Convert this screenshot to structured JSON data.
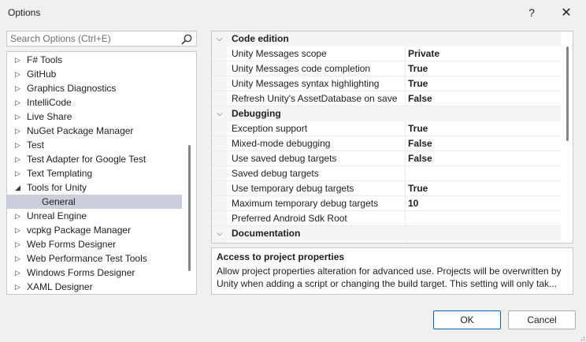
{
  "window": {
    "title": "Options",
    "help_glyph": "?",
    "close_glyph": "✕"
  },
  "search": {
    "placeholder": "Search Options (Ctrl+E)"
  },
  "tree": [
    {
      "label": "F# Tools",
      "arrow": "▷"
    },
    {
      "label": "GitHub",
      "arrow": "▷"
    },
    {
      "label": "Graphics Diagnostics",
      "arrow": "▷"
    },
    {
      "label": "IntelliCode",
      "arrow": "▷"
    },
    {
      "label": "Live Share",
      "arrow": "▷"
    },
    {
      "label": "NuGet Package Manager",
      "arrow": "▷"
    },
    {
      "label": "Test",
      "arrow": "▷"
    },
    {
      "label": "Test Adapter for Google Test",
      "arrow": "▷"
    },
    {
      "label": "Text Templating",
      "arrow": "▷"
    },
    {
      "label": "Tools for Unity",
      "arrow": "◢"
    },
    {
      "label": "General",
      "arrow": ""
    },
    {
      "label": "Unreal Engine",
      "arrow": "▷"
    },
    {
      "label": "vcpkg Package Manager",
      "arrow": "▷"
    },
    {
      "label": "Web Forms Designer",
      "arrow": "▷"
    },
    {
      "label": "Web Performance Test Tools",
      "arrow": "▷"
    },
    {
      "label": "Windows Forms Designer",
      "arrow": "▷"
    },
    {
      "label": "XAML Designer",
      "arrow": "▷"
    }
  ],
  "grid": {
    "code_edition": "Code edition",
    "debugging": "Debugging",
    "documentation": "Documentation",
    "collapse_glyph": "⌵",
    "code_props": [
      {
        "name": "Unity Messages scope",
        "value": "Private"
      },
      {
        "name": "Unity Messages code completion",
        "value": "True"
      },
      {
        "name": "Unity Messages syntax highlighting",
        "value": "True"
      },
      {
        "name": "Refresh Unity's AssetDatabase on save",
        "value": "False"
      }
    ],
    "debug_props": [
      {
        "name": "Exception support",
        "value": "True"
      },
      {
        "name": "Mixed-mode debugging",
        "value": "False"
      },
      {
        "name": "Use saved debug targets",
        "value": "False"
      },
      {
        "name": "Saved debug targets",
        "value": ""
      },
      {
        "name": "Use temporary debug targets",
        "value": "True"
      },
      {
        "name": "Maximum temporary debug targets",
        "value": "10"
      },
      {
        "name": "Preferred Android Sdk Root",
        "value": ""
      }
    ]
  },
  "description": {
    "title": "Access to project properties",
    "text": "Allow project properties alteration for advanced use. Projects will be overwritten by Unity when adding a script or changing the build target. This setting will only tak..."
  },
  "buttons": {
    "ok": "OK",
    "cancel": "Cancel"
  }
}
